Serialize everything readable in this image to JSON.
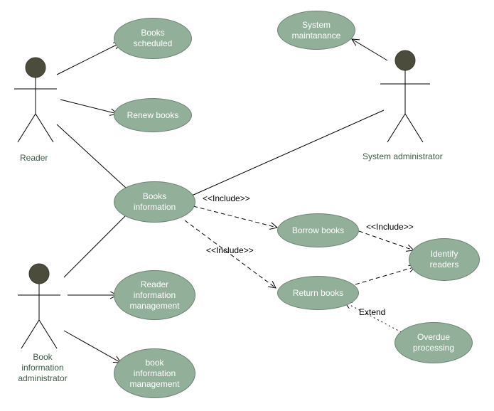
{
  "actors": {
    "reader": "Reader",
    "bookAdmin": "Book\ninformation\nadministrator",
    "sysAdmin": "System administrator"
  },
  "usecases": {
    "booksScheduled": "Books\nscheduled",
    "renewBooks": "Renew books",
    "booksInfo": "Books\ninformation",
    "readerInfoMgmt": "Reader\ninformation\nmanagement",
    "bookInfoMgmt": "book\ninformation\nmanagement",
    "systemMaint": "System\nmaintanance",
    "borrowBooks": "Borrow books",
    "identifyReaders": "Identify\nreaders",
    "returnBooks": "Return books",
    "overdueProc": "Overdue\nprocessing"
  },
  "relations": {
    "include1": "<<Include>>",
    "include2": "<<Include>>",
    "include3": "<<Include>>",
    "extend": "Extend"
  }
}
